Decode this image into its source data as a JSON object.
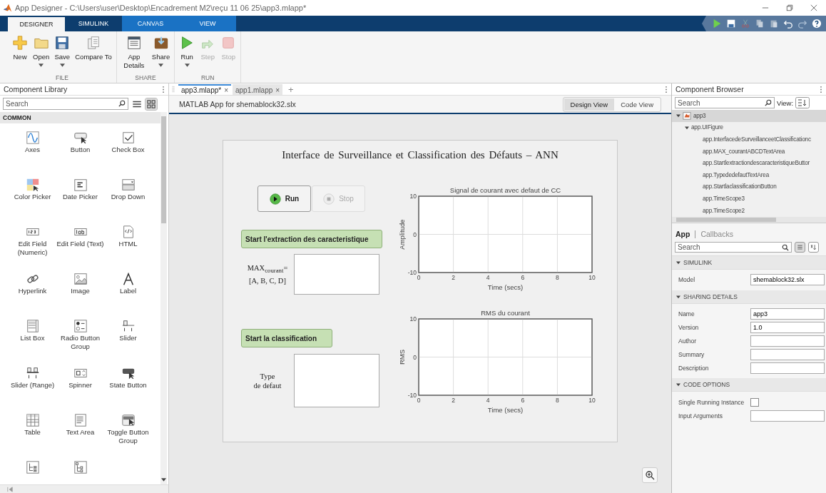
{
  "window": {
    "title": "App Designer - C:\\Users\\user\\Desktop\\Encadrement M2\\reçu 11 06 25\\app3.mlapp*"
  },
  "ribbon_tabs": [
    {
      "label": "DESIGNER",
      "selected": true,
      "contextual": false
    },
    {
      "label": "SIMULINK",
      "selected": false,
      "contextual": false
    },
    {
      "label": "CANVAS",
      "selected": false,
      "contextual": true
    },
    {
      "label": "VIEW",
      "selected": false,
      "contextual": true
    }
  ],
  "toolstrip_groups": [
    {
      "label": "FILE",
      "tools": [
        {
          "kind": "new",
          "label": "New",
          "dropdown": false,
          "disabled": false
        },
        {
          "kind": "open",
          "label": "Open",
          "dropdown": true,
          "disabled": false
        },
        {
          "kind": "save",
          "label": "Save",
          "dropdown": true,
          "disabled": false
        },
        {
          "kind": "compare",
          "label": "Compare To",
          "dropdown": false,
          "disabled": false
        }
      ]
    },
    {
      "label": "SHARE",
      "tools": [
        {
          "kind": "details",
          "label": "App Details",
          "dropdown": false,
          "disabled": false
        },
        {
          "kind": "share",
          "label": "Share",
          "dropdown": true,
          "disabled": false
        }
      ]
    },
    {
      "label": "RUN",
      "tools": [
        {
          "kind": "run",
          "label": "Run",
          "dropdown": true,
          "disabled": false
        },
        {
          "kind": "step",
          "label": "Step",
          "dropdown": false,
          "disabled": true
        },
        {
          "kind": "stop",
          "label": "Stop",
          "dropdown": false,
          "disabled": true
        }
      ]
    }
  ],
  "library": {
    "title": "Component Library",
    "search": {
      "placeholder": "Search"
    },
    "section": "COMMON",
    "items": [
      {
        "kind": "axes",
        "label": "Axes"
      },
      {
        "kind": "button",
        "label": "Button"
      },
      {
        "kind": "checkbox",
        "label": "Check Box"
      },
      {
        "kind": "color",
        "label": "Color Picker"
      },
      {
        "kind": "date",
        "label": "Date Picker"
      },
      {
        "kind": "dropdown",
        "label": "Drop Down"
      },
      {
        "kind": "numeric",
        "label": "Edit Field (Numeric)"
      },
      {
        "kind": "text",
        "label": "Edit Field (Text)"
      },
      {
        "kind": "html",
        "label": "HTML"
      },
      {
        "kind": "link",
        "label": "Hyperlink"
      },
      {
        "kind": "image",
        "label": "Image"
      },
      {
        "kind": "label",
        "label": "Label"
      },
      {
        "kind": "listbox",
        "label": "List Box"
      },
      {
        "kind": "radio",
        "label": "Radio Button Group"
      },
      {
        "kind": "slider",
        "label": "Slider"
      },
      {
        "kind": "range",
        "label": "Slider (Range)"
      },
      {
        "kind": "spinner",
        "label": "Spinner"
      },
      {
        "kind": "state",
        "label": "State Button"
      },
      {
        "kind": "table",
        "label": "Table"
      },
      {
        "kind": "textarea",
        "label": "Text Area"
      },
      {
        "kind": "toggle",
        "label": "Toggle Button Group"
      },
      {
        "kind": "tree"
      },
      {
        "kind": "treecheck"
      }
    ]
  },
  "doc_tabs": [
    {
      "label": "app3.mlapp*",
      "close": "×",
      "selected": true
    },
    {
      "label": "app1.mlapp",
      "close": "×",
      "selected": false
    }
  ],
  "new_tab": "+",
  "canvas_header": "MATLAB App for shemablock32.slx",
  "views": [
    {
      "label": "Design View",
      "selected": true
    },
    {
      "label": "Code View",
      "selected": false
    }
  ],
  "figure": {
    "title": "Interface de Surveillance et Classification des Défauts – ANN",
    "run_buttons": [
      {
        "kind": "run",
        "label": "Run",
        "disabled": false
      },
      {
        "kind": "stop",
        "label": "Stop",
        "disabled": true
      }
    ],
    "extract_button": "Start l'extraction des caracteristique",
    "max_label": [
      "MAX$_{courant}$=",
      "[A, B, C, D]"
    ],
    "classify_button": "Start la classification",
    "type_label": [
      "Type",
      "de defaut"
    ],
    "scopes": [
      {
        "chart_data": {
          "type": "line",
          "title": "Signal de courant avec defaut de CC",
          "xlabel": "Time (secs)",
          "ylabel": "Amplitude",
          "xlim": [
            0,
            10
          ],
          "ylim": [
            -10,
            10
          ],
          "xticks": [
            0,
            2,
            4,
            6,
            8,
            10
          ],
          "yticks": [
            -10,
            0,
            10
          ],
          "grid": true
        }
      },
      {
        "chart_data": {
          "type": "line",
          "title": "RMS du courant",
          "xlabel": "Time (secs)",
          "ylabel": "RMS",
          "xlim": [
            0,
            10
          ],
          "ylim": [
            -10,
            10
          ],
          "xticks": [
            0,
            2,
            4,
            6,
            8,
            10
          ],
          "yticks": [
            -10,
            0,
            10
          ],
          "grid": true
        }
      }
    ]
  },
  "browser": {
    "title": "Component Browser",
    "search": {
      "placeholder": "Search"
    },
    "view_label": "View:",
    "tree": [
      {
        "label": "app3",
        "kind": "app",
        "expanded": true,
        "selected": true,
        "children": [
          {
            "label": "app.UIFigure",
            "expanded": true,
            "selected": false,
            "children": [
              {
                "label": "app.InterfacedeSurveillanceetClassificationc",
                "selected": false
              },
              {
                "label": "app.MAX_courantABCDTextArea",
                "selected": false
              },
              {
                "label": "app.StartlextractiondescaracteristiqueButtor",
                "selected": false
              },
              {
                "label": "app.TypededefautTextArea",
                "selected": false
              },
              {
                "label": "app.StartlaclassificationButton",
                "selected": false
              },
              {
                "label": "app.TimeScope3",
                "selected": false
              },
              {
                "label": "app.TimeScope2",
                "selected": false
              }
            ]
          }
        ]
      }
    ]
  },
  "inspector": {
    "tabs": [
      {
        "label": "App",
        "selected": true
      },
      {
        "label": "Callbacks",
        "selected": false
      }
    ],
    "search": {
      "placeholder": "Search"
    },
    "sections": [
      {
        "title": "SIMULINK",
        "expanded": true,
        "rows": [
          {
            "kind": "field",
            "label": "Model",
            "value": "shemablock32.slx"
          }
        ]
      },
      {
        "title": "SHARING DETAILS",
        "expanded": true,
        "rows": [
          {
            "kind": "field",
            "label": "Name",
            "value": "app3"
          },
          {
            "kind": "field",
            "label": "Version",
            "value": "1.0"
          },
          {
            "kind": "field",
            "label": "Author"
          },
          {
            "kind": "field",
            "label": "Summary"
          },
          {
            "kind": "field",
            "label": "Description"
          }
        ]
      },
      {
        "title": "CODE OPTIONS",
        "expanded": true,
        "rows": [
          {
            "kind": "checkbox",
            "label": "Single Running Instance",
            "checked": false
          },
          {
            "kind": "field",
            "label": "Input Arguments"
          }
        ]
      }
    ]
  }
}
